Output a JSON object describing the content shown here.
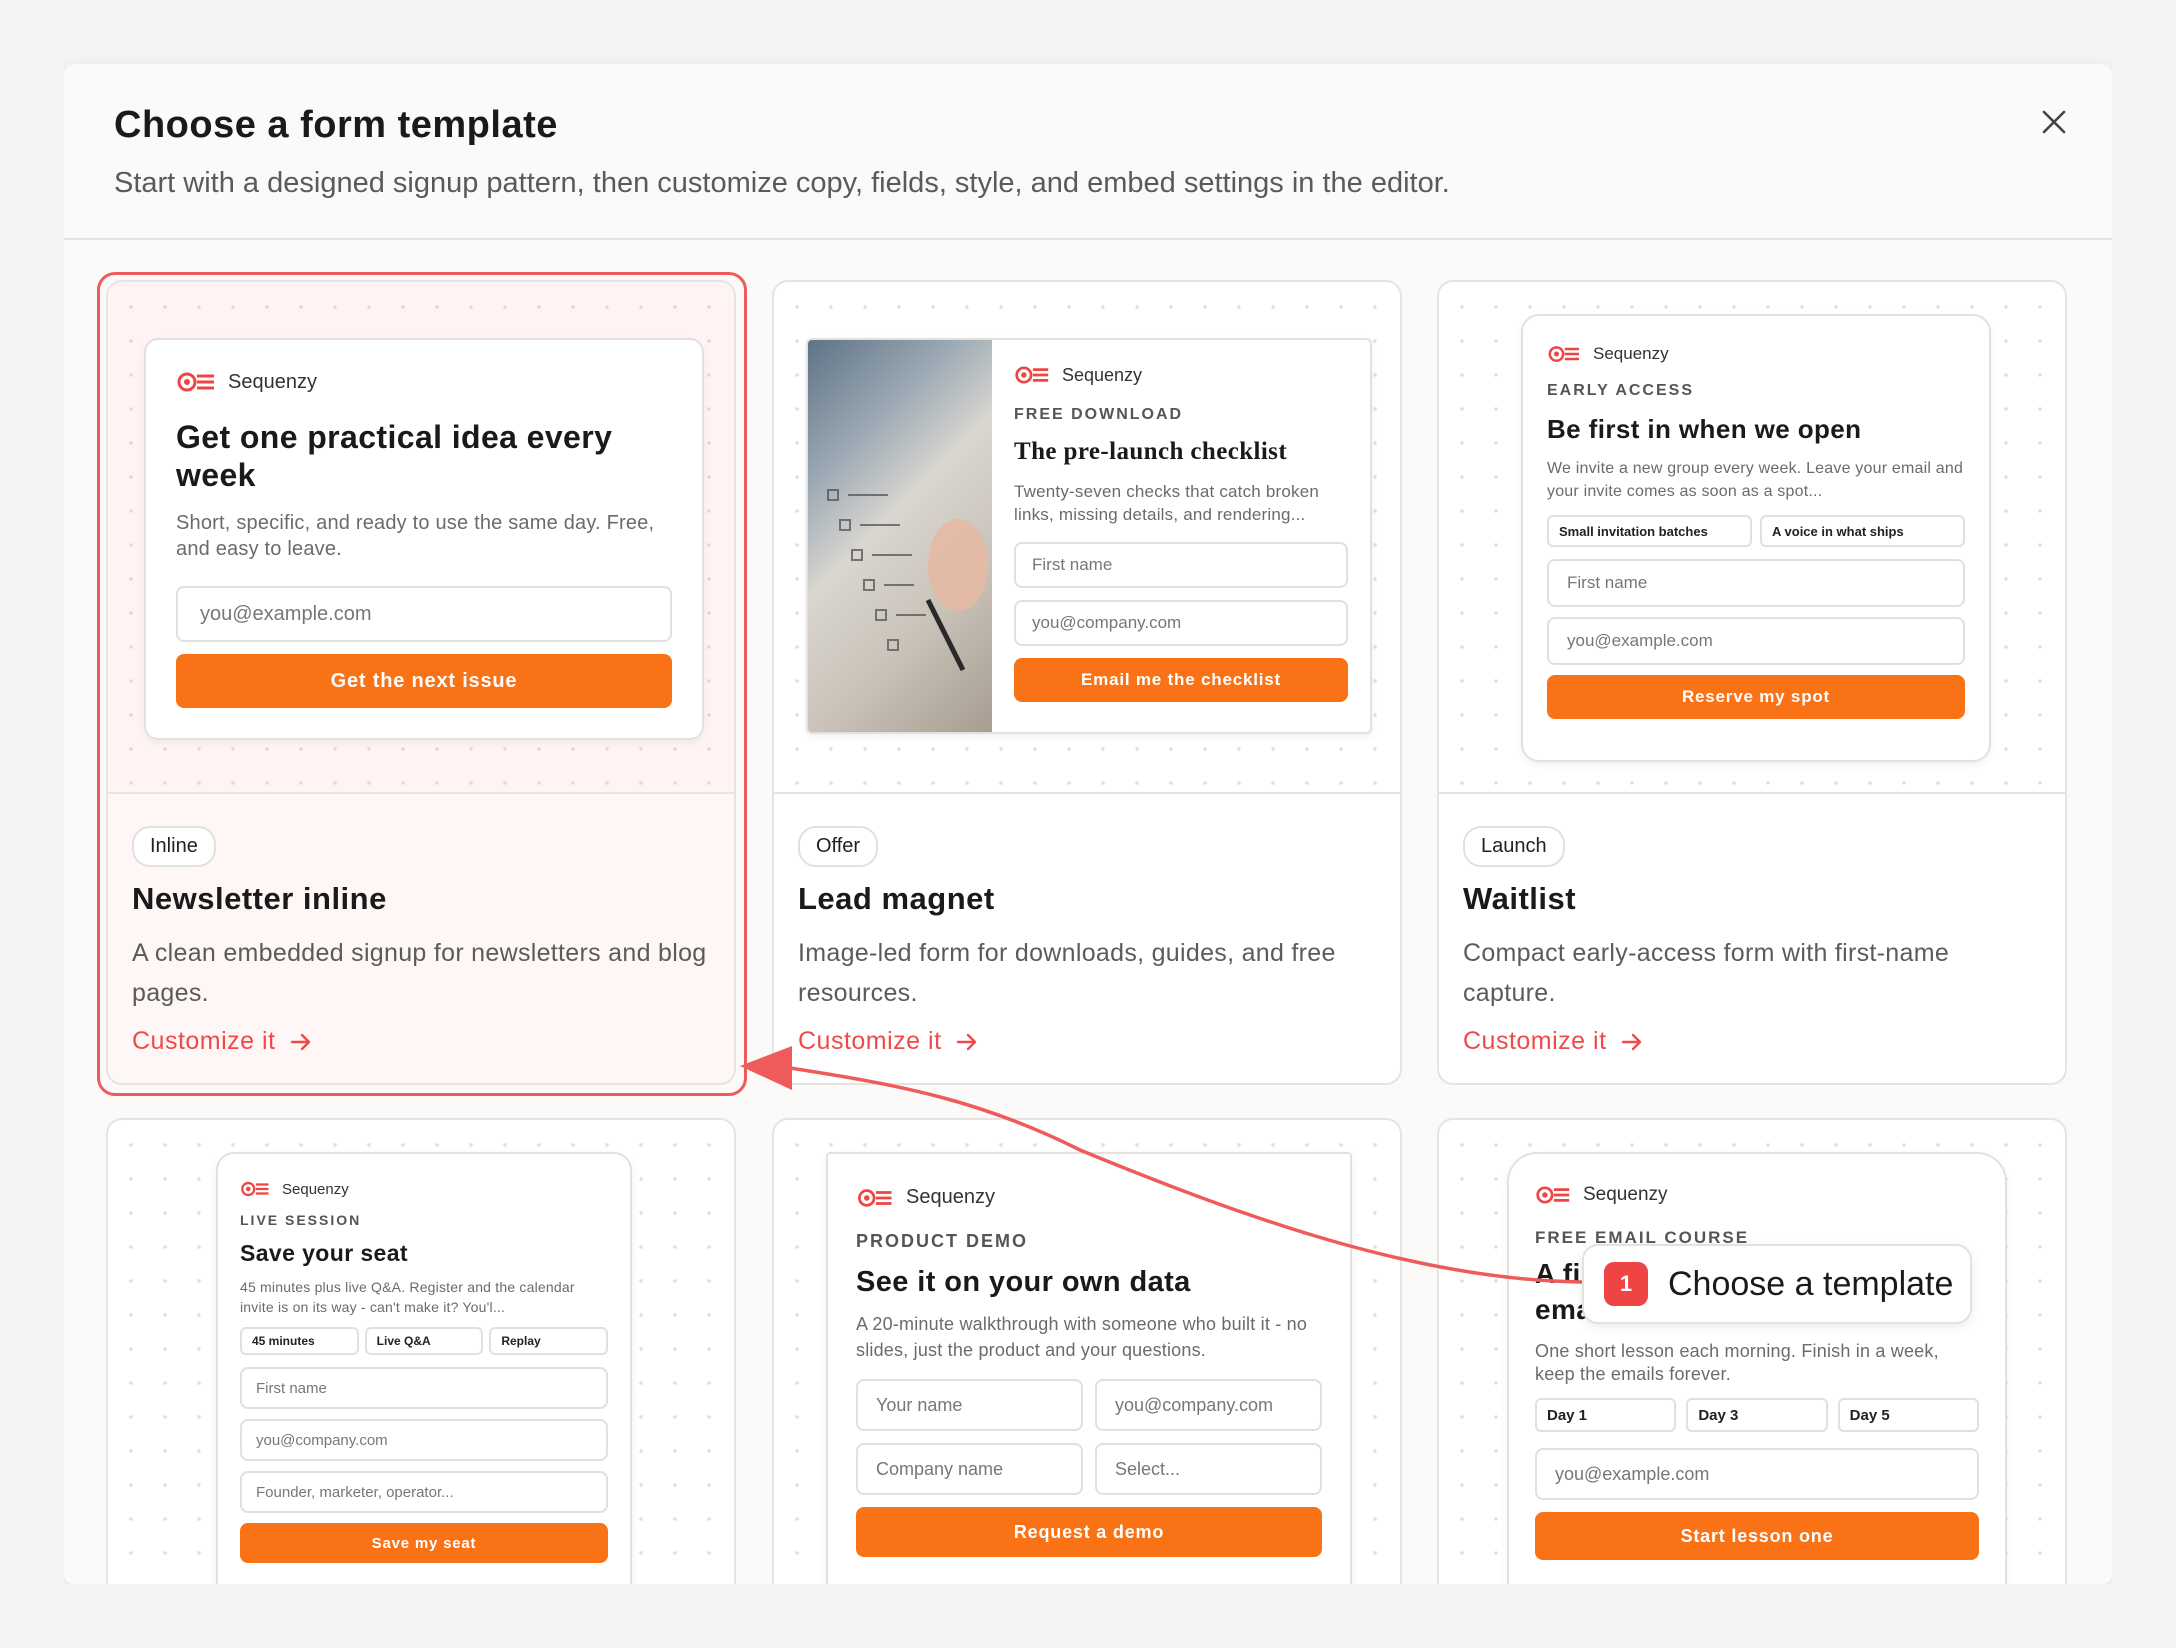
{
  "modal": {
    "title": "Choose a form template",
    "subtitle": "Start with a designed signup pattern, then customize copy, fields, style, and embed settings in the editor."
  },
  "cards": [
    {
      "tag": "Inline",
      "title": "Newsletter inline",
      "desc": "A clean embedded signup for newsletters and blog pages.",
      "cta": "Customize it",
      "preview": {
        "brand": "Sequenzy",
        "heading": "Get one practical idea every week",
        "body": "Short, specific, and ready to use the same day. Free, and easy to leave.",
        "email_placeholder": "you@example.com",
        "button": "Get the next issue"
      }
    },
    {
      "tag": "Offer",
      "title": "Lead magnet",
      "desc": "Image-led form for downloads, guides, and free resources.",
      "cta": "Customize it",
      "preview": {
        "brand": "Sequenzy",
        "eyebrow": "FREE DOWNLOAD",
        "heading": "The pre-launch checklist",
        "body": "Twenty-seven checks that catch broken links, missing details, and rendering...",
        "first_placeholder": "First name",
        "email_placeholder": "you@company.com",
        "button": "Email me the checklist"
      }
    },
    {
      "tag": "Launch",
      "title": "Waitlist",
      "desc": "Compact early-access form with first-name capture.",
      "cta": "Customize it",
      "preview": {
        "brand": "Sequenzy",
        "eyebrow": "EARLY ACCESS",
        "heading": "Be first in when we open",
        "body": "We invite a new group every week. Leave your email and your invite comes as soon as a spot...",
        "chips": [
          "Small invitation batches",
          "A voice in what ships"
        ],
        "first_placeholder": "First name",
        "email_placeholder": "you@example.com",
        "button": "Reserve my spot"
      }
    },
    {
      "preview": {
        "brand": "Sequenzy",
        "eyebrow": "LIVE SESSION",
        "heading": "Save your seat",
        "body": "45 minutes plus live Q&A. Register and the calendar invite is on its way - can't make it? You'l...",
        "chips": [
          "45 minutes",
          "Live Q&A",
          "Replay"
        ],
        "first_placeholder": "First name",
        "email_placeholder": "you@company.com",
        "role_placeholder": "Founder, marketer, operator...",
        "button": "Save my seat"
      }
    },
    {
      "preview": {
        "brand": "Sequenzy",
        "eyebrow": "PRODUCT DEMO",
        "heading": "See it on your own data",
        "body": "A 20-minute walkthrough with someone who built it - no slides, just the product and your questions.",
        "name_placeholder": "Your name",
        "email_placeholder": "you@company.com",
        "company_placeholder": "Company name",
        "select_placeholder": "Select...",
        "button": "Request a demo"
      }
    },
    {
      "preview": {
        "brand": "Sequenzy",
        "eyebrow": "FREE EMAIL COURSE",
        "heading_a": "A fi",
        "heading_b": "emai",
        "body": "One short lesson each morning. Finish in a week, keep the emails forever.",
        "chips": [
          "Day 1",
          "Day 3",
          "Day 5"
        ],
        "email_placeholder": "you@example.com",
        "button": "Start lesson one"
      }
    }
  ],
  "callout": {
    "number": "1",
    "text": "Choose a template"
  },
  "colors": {
    "accent": "#f97316",
    "selection": "#ef5b5b",
    "brand": "#ef4444"
  }
}
